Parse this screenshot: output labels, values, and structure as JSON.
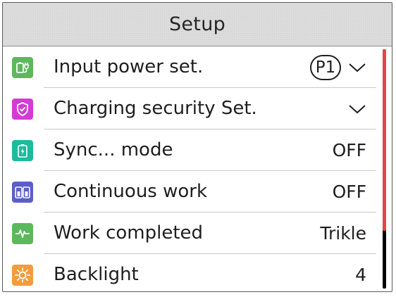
{
  "header": {
    "title": "Setup"
  },
  "items": [
    {
      "label": "Input power set.",
      "badge": "P1",
      "value": "",
      "dropdown": true,
      "icon": "plug-icon",
      "color": "#5cb85c"
    },
    {
      "label": "Charging security Set.",
      "badge": "",
      "value": "",
      "dropdown": true,
      "icon": "shield-icon",
      "color": "#d63ad6"
    },
    {
      "label": "Sync... mode",
      "badge": "",
      "value": "OFF",
      "dropdown": false,
      "icon": "battery-bolt-icon",
      "color": "#1abc9c"
    },
    {
      "label": "Continuous work",
      "badge": "",
      "value": "OFF",
      "dropdown": false,
      "icon": "dual-battery-icon",
      "color": "#5a5fc8"
    },
    {
      "label": "Work completed",
      "badge": "",
      "value": "Trikle",
      "dropdown": false,
      "icon": "pulse-icon",
      "color": "#5cb85c"
    },
    {
      "label": "Backlight",
      "badge": "",
      "value": "4",
      "dropdown": false,
      "icon": "sun-icon",
      "color": "#f39c3d"
    }
  ],
  "scrollbar": {
    "position": 0.0,
    "visible_fraction": 0.76,
    "thumb_color": "#e24646",
    "track_color": "#000000"
  }
}
